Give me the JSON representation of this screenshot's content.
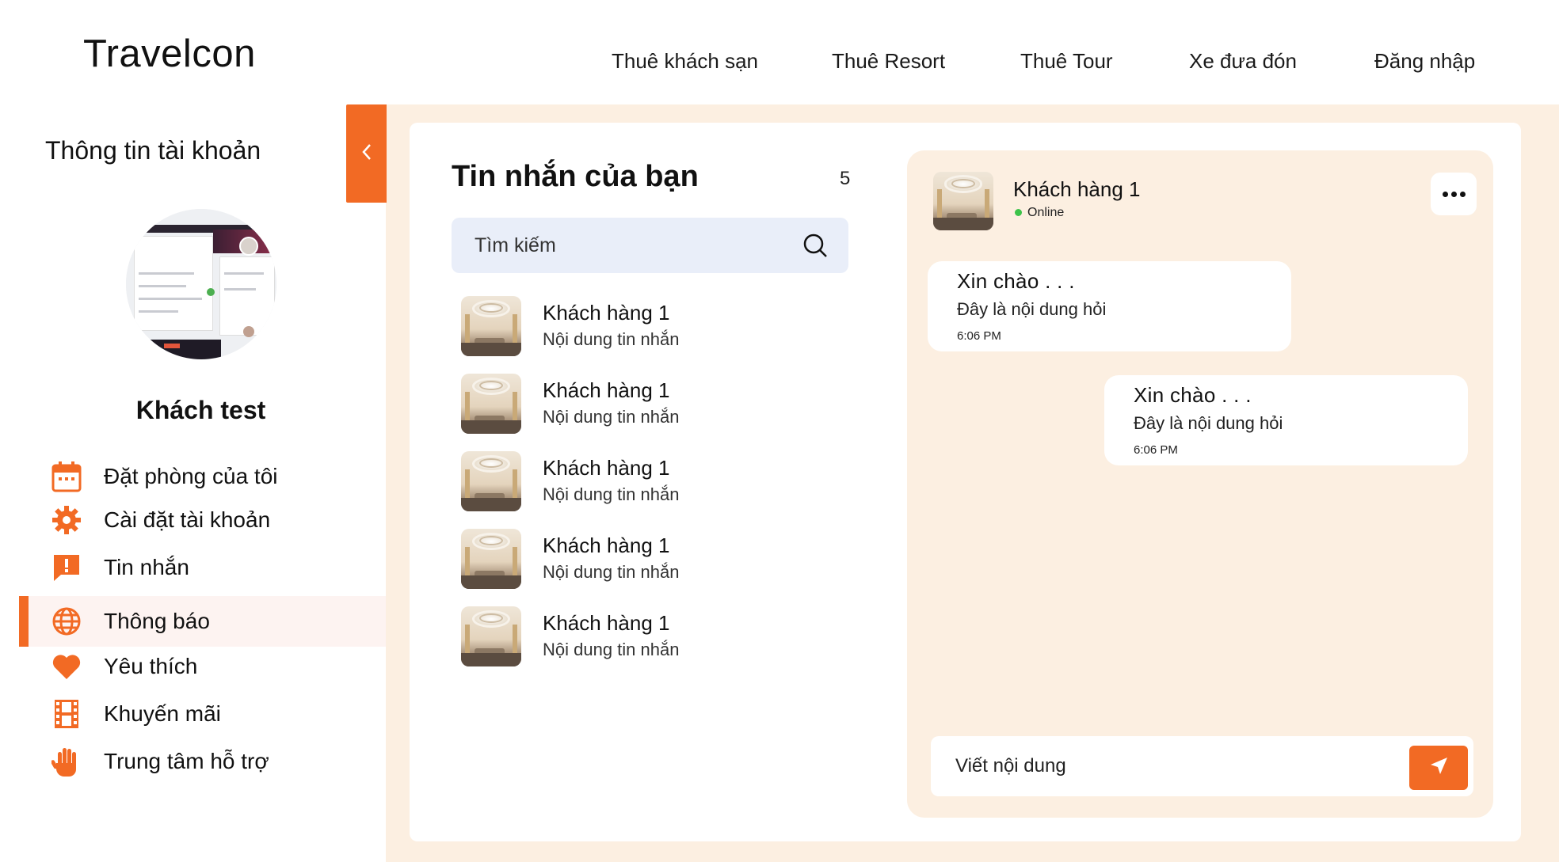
{
  "header": {
    "logo": "Travelcon",
    "nav": [
      {
        "label": "Thuê khách sạn"
      },
      {
        "label": "Thuê Resort"
      },
      {
        "label": "Thuê Tour"
      },
      {
        "label": "Xe đưa đón"
      },
      {
        "label": "Đăng nhập"
      }
    ]
  },
  "sidebar": {
    "title": "Thông tin tài khoản",
    "user_name": "Khách test",
    "menu": [
      {
        "label": "Đặt phòng của tôi",
        "icon": "calendar-icon"
      },
      {
        "label": "Cài đặt tài khoản",
        "icon": "gear-icon"
      },
      {
        "label": "Tin nhắn",
        "icon": "chat-alert-icon"
      },
      {
        "label": "Thông báo",
        "icon": "globe-icon",
        "active": true
      },
      {
        "label": "Yêu thích",
        "icon": "heart-icon"
      },
      {
        "label": "Khuyến mãi",
        "icon": "film-icon"
      },
      {
        "label": "Trung tâm hỗ trợ",
        "icon": "hand-icon"
      }
    ],
    "accent_color": "#f26a24"
  },
  "messages": {
    "title": "Tin nhắn của bạn",
    "count": "5",
    "search_placeholder": "Tìm kiếm",
    "conversations": [
      {
        "name": "Khách hàng 1",
        "preview": "Nội dung tin nhắn"
      },
      {
        "name": "Khách hàng 1",
        "preview": "Nội dung tin nhắn"
      },
      {
        "name": "Khách hàng 1",
        "preview": "Nội dung tin nhắn"
      },
      {
        "name": "Khách hàng 1",
        "preview": "Nội dung tin nhắn"
      },
      {
        "name": "Khách hàng 1",
        "preview": "Nội dung tin nhắn"
      }
    ]
  },
  "chat": {
    "contact_name": "Khách hàng 1",
    "status": "Online",
    "bubbles": [
      {
        "title": "Xin chào . . .",
        "text": "Đây là nội dung hỏi",
        "time": "6:06 PM"
      },
      {
        "title": "Xin chào . . .",
        "text": "Đây là nội dung hỏi",
        "time": "6:06 PM"
      }
    ],
    "compose_placeholder": "Viết nội dung"
  }
}
